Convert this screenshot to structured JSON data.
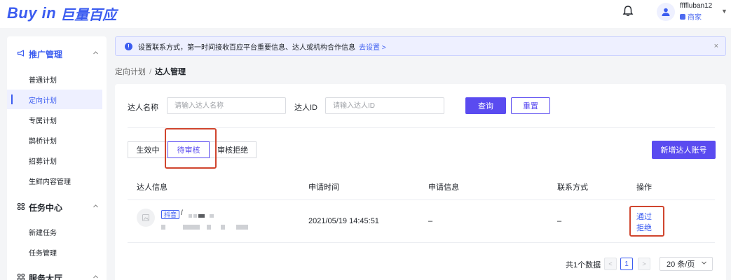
{
  "header": {
    "logo_en": "Buy in",
    "logo_cn": "巨量百应",
    "username": "ffffluban12",
    "role": "商家",
    "user_menu_caret": "▼"
  },
  "sidebar": {
    "groups": [
      {
        "label": "推广管理",
        "icon": "megaphone-icon",
        "items": [
          {
            "label": "普通计划"
          },
          {
            "label": "定向计划",
            "active": true
          },
          {
            "label": "专属计划"
          },
          {
            "label": "鹊桥计划"
          },
          {
            "label": "招募计划"
          },
          {
            "label": "生鲜内容管理"
          }
        ]
      },
      {
        "label": "任务中心",
        "icon": "grid-icon",
        "items": [
          {
            "label": "新建任务"
          },
          {
            "label": "任务管理"
          }
        ]
      },
      {
        "label": "服务大厅",
        "icon": "grid-icon",
        "items": []
      }
    ]
  },
  "notice": {
    "text": "设置联系方式，第一时间接收百应平台重要信息、达人或机构合作信息",
    "link": "去设置",
    "close": "×"
  },
  "breadcrumb": {
    "parent": "定向计划",
    "separator": "/",
    "current": "达人管理"
  },
  "filters": {
    "name_label": "达人名称",
    "name_placeholder": "请输入达人名称",
    "id_label": "达人ID",
    "id_placeholder": "请输入达人ID",
    "search_button": "查询",
    "reset_button": "重置"
  },
  "tabs": [
    {
      "label": "生效中",
      "active": false
    },
    {
      "label": "待审核",
      "active": true
    },
    {
      "label": "审核拒绝",
      "active": false
    }
  ],
  "add_button": "新增达人账号",
  "table": {
    "columns": [
      "达人信息",
      "申请时间",
      "申请信息",
      "联系方式",
      "操作"
    ],
    "rows": [
      {
        "platform": "抖音",
        "name_sep": "/",
        "apply_time": "2021/05/19 14:45:51",
        "apply_info": "–",
        "contact": "–",
        "actions": [
          "通过",
          "拒绝"
        ]
      }
    ]
  },
  "pagination": {
    "total": "共1个数据",
    "prev": "<",
    "current_page": "1",
    "next": ">",
    "page_size": "20 条/页"
  },
  "colors": {
    "accent": "#5a4bf0",
    "link": "#3b5cf0",
    "highlight": "#d0452e"
  }
}
